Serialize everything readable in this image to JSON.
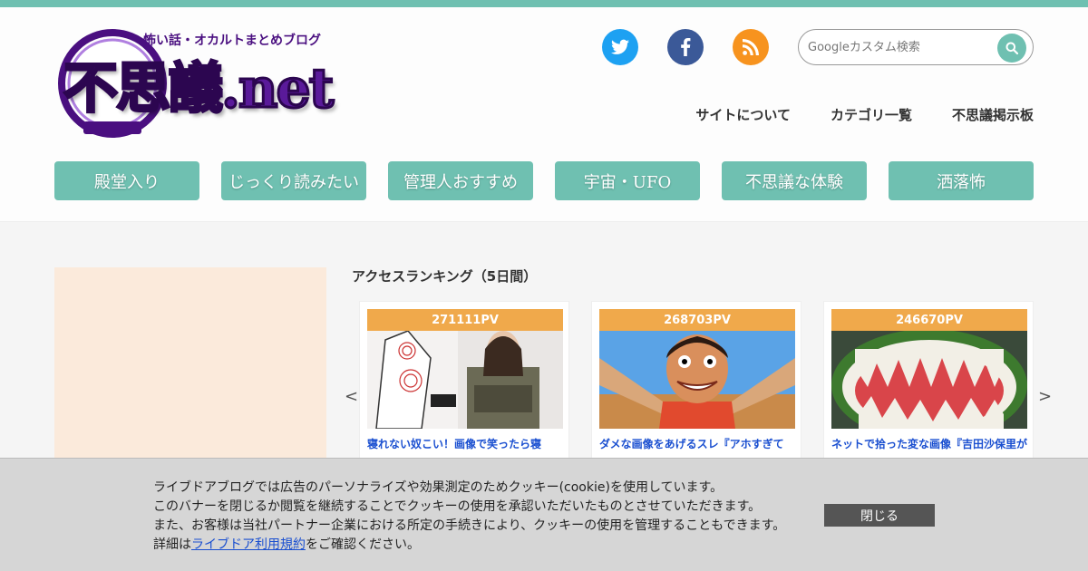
{
  "site": {
    "tagline": "怖い話・オカルトまとめブログ",
    "logo_text": "不思議.net"
  },
  "social": [
    {
      "icon": "twitter-icon",
      "color": "#1da1f2"
    },
    {
      "icon": "facebook-icon",
      "color": "#3b5998"
    },
    {
      "icon": "rss-icon",
      "color": "#f7931e"
    }
  ],
  "search": {
    "placeholder": "Googleカスタム検索"
  },
  "toplinks": [
    "サイトについて",
    "カテゴリ一覧",
    "不思議掲示板"
  ],
  "nav": [
    "殿堂入り",
    "じっくり読みたい",
    "管理人おすすめ",
    "宇宙・UFO",
    "不思議な体験",
    "洒落怖"
  ],
  "ranking": {
    "title": "アクセスランキング（5日間）",
    "prev": "<",
    "next": ">",
    "items": [
      {
        "pv": "271111PV",
        "title": "寝れない奴こい！画像で笑ったら寝"
      },
      {
        "pv": "268703PV",
        "title": "ダメな画像をあげるスレ『アホすぎて"
      },
      {
        "pv": "246670PV",
        "title": "ネットで拾った変な画像『吉田沙保里が"
      }
    ]
  },
  "cookie": {
    "line1": "ライブドアブログでは広告のパーソナライズや効果測定のためクッキー(cookie)を使用しています。",
    "line2": "このバナーを閉じるか閲覧を継続することでクッキーの使用を承認いただいたものとさせていただきます。",
    "line3": "また、お客様は当社パートナー企業における所定の手続きにより、クッキーの使用を管理することもできます。",
    "line4_prefix": "詳細は",
    "line4_link": "ライブドア利用規約",
    "line4_suffix": "をご確認ください。",
    "close": "閉じる"
  },
  "colors": {
    "accent": "#6fc0b1",
    "pv_badge": "#f0a94b",
    "logo_purple": "#4a0f80"
  }
}
